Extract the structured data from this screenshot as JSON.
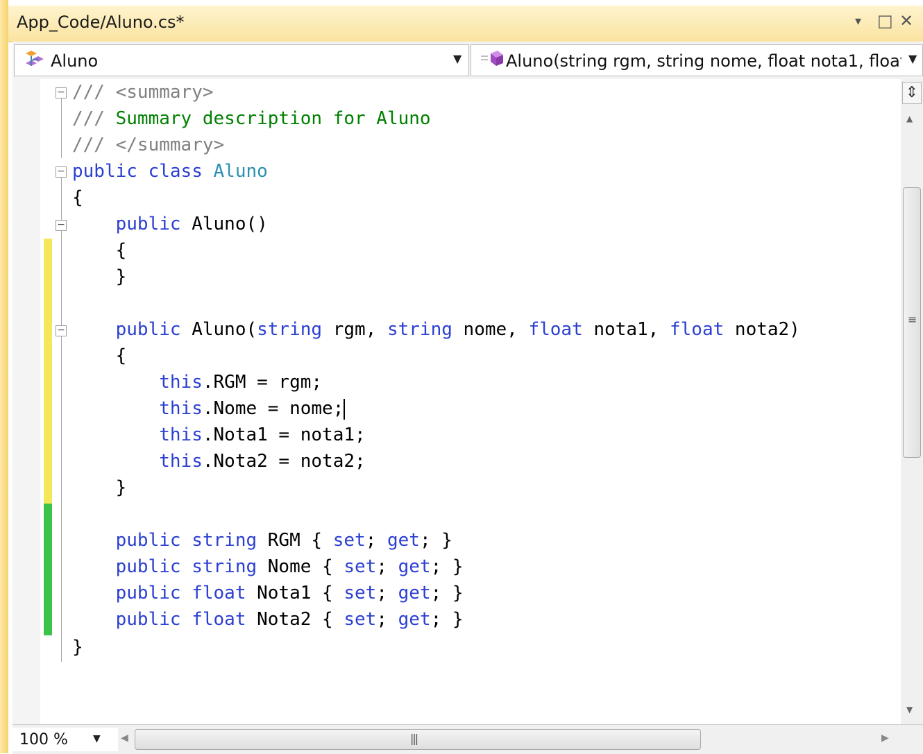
{
  "window": {
    "title": "App_Code/Aluno.cs*",
    "controls": {
      "dropdown": "▾",
      "maximize": "□",
      "close": "✕"
    }
  },
  "navbar": {
    "class_combo": {
      "label": "Aluno",
      "icon": "class-icon"
    },
    "member_combo": {
      "label": "Aluno(string rgm, string nome, float nota1, float",
      "icon": "method-icon"
    }
  },
  "code": {
    "l1": {
      "a": "/// ",
      "b": "<summary>"
    },
    "l2": {
      "a": "/// ",
      "b": "Summary description for Aluno"
    },
    "l3": {
      "a": "/// ",
      "b": "</summary>"
    },
    "l4": {
      "kw1": "public",
      "kw2": "class",
      "name": "Aluno"
    },
    "l5": "{",
    "l6": {
      "kw": "public",
      "rest": " Aluno()"
    },
    "l7": "{",
    "l8": "}",
    "l10": {
      "kw": "public",
      "p0": " Aluno(",
      "t1": "string",
      "p1": " rgm, ",
      "t2": "string",
      "p2": " nome, ",
      "t3": "float",
      "p3": " nota1, ",
      "t4": "float",
      "p4": " nota2)"
    },
    "l11": "{",
    "l12": {
      "kw": "this",
      "rest": ".RGM = rgm;"
    },
    "l13": {
      "kw": "this",
      "rest": ".Nome = nome;"
    },
    "l14": {
      "kw": "this",
      "rest": ".Nota1 = nota1;"
    },
    "l15": {
      "kw": "this",
      "rest": ".Nota2 = nota2;"
    },
    "l16": "}",
    "l18": {
      "k1": "public",
      "t": "string",
      "name": " RGM { ",
      "s": "set",
      "g": "get",
      "end": "; }"
    },
    "l19": {
      "k1": "public",
      "t": "string",
      "name": " Nome { ",
      "s": "set",
      "g": "get",
      "end": "; }"
    },
    "l20": {
      "k1": "public",
      "t": "float",
      "name": " Nota1 { ",
      "s": "set",
      "g": "get",
      "end": "; }"
    },
    "l21": {
      "k1": "public",
      "t": "float",
      "name": " Nota2 { ",
      "s": "set",
      "g": "get",
      "end": "; }"
    },
    "l22": "}"
  },
  "change_markers": {
    "unsaved_color": "#f2e85a",
    "saved_color": "#3cc24a"
  },
  "colors": {
    "keyword": "#2b3fd1",
    "type": "#2b91af",
    "comment": "#008000",
    "xmldoc": "#808080"
  },
  "statusbar": {
    "zoom": "100 %"
  }
}
